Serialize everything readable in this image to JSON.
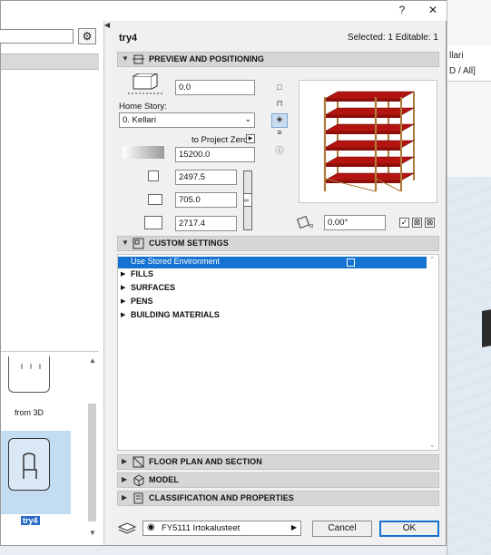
{
  "window": {
    "help_label": "?",
    "close_label": "✕",
    "splitter_arrow": "◀"
  },
  "background_app": {
    "text1": "llari",
    "text2": "D / All]"
  },
  "left_panel": {
    "search_value": "",
    "search_options_glyph": "⚙",
    "items": [
      {
        "label": "from 3D"
      },
      {
        "label": "try4"
      }
    ]
  },
  "header": {
    "title": "try4",
    "selection_info": "Selected: 1 Editable: 1"
  },
  "sections": {
    "preview_positioning": "PREVIEW AND POSITIONING",
    "custom_settings": "CUSTOM SETTINGS",
    "floor_plan": "FLOOR PLAN AND SECTION",
    "model": "MODEL",
    "classification": "CLASSIFICATION AND PROPERTIES"
  },
  "positioning": {
    "elevation_value": "0.0",
    "home_story_label": "Home Story:",
    "home_story_value": "0. Kellari",
    "to_project_zero_label": "to Project Zero",
    "project_zero_value": "15200.0",
    "width_value": "2497.5",
    "depth_value": "705.0",
    "height_value": "2717.4",
    "rotation_value": "0.00°"
  },
  "custom_settings": {
    "rows": [
      {
        "label": "Use Stored Environment",
        "selected": true
      },
      {
        "label": "FILLS"
      },
      {
        "label": "SURFACES"
      },
      {
        "label": "PENS"
      },
      {
        "label": "BUILDING MATERIALS"
      }
    ]
  },
  "footer": {
    "layer_value": "FY5111 Irtokalusteet",
    "cancel_label": "Cancel",
    "ok_label": "OK"
  },
  "colors": {
    "accent": "#1673d1",
    "shelf_red": "#b3140f",
    "frame_wood": "#b07a3a"
  }
}
